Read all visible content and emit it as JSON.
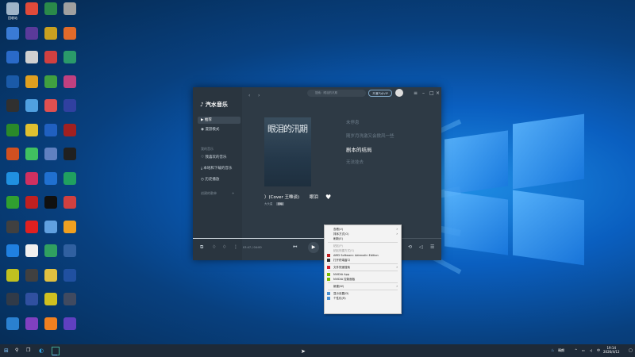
{
  "desktop": {
    "icons": [
      {
        "label": "回收站",
        "color": "#9fb4c8"
      },
      {
        "label": "",
        "color": "#e04a3a"
      },
      {
        "label": "",
        "color": "#2a8a4a"
      },
      {
        "label": "",
        "color": "#a0a0a0"
      },
      {
        "label": "",
        "color": "#3a7bd5"
      },
      {
        "label": "",
        "color": "#5a3a9a"
      },
      {
        "label": "",
        "color": "#c8a020"
      },
      {
        "label": "",
        "color": "#e06a2a"
      },
      {
        "label": "",
        "color": "#2a6ac8"
      },
      {
        "label": "",
        "color": "#d0d0d0"
      },
      {
        "label": "",
        "color": "#d04040"
      },
      {
        "label": "",
        "color": "#2a9a6a"
      },
      {
        "label": "",
        "color": "#1a5aa8"
      },
      {
        "label": "",
        "color": "#e0a020"
      },
      {
        "label": "",
        "color": "#40a040"
      },
      {
        "label": "",
        "color": "#c04080"
      },
      {
        "label": "",
        "color": "#303030"
      },
      {
        "label": "",
        "color": "#50a0e0"
      },
      {
        "label": "",
        "color": "#e05050"
      },
      {
        "label": "",
        "color": "#3040a0"
      },
      {
        "label": "",
        "color": "#2a8a2a"
      },
      {
        "label": "",
        "color": "#e0c030"
      },
      {
        "label": "",
        "color": "#2060c0"
      },
      {
        "label": "",
        "color": "#a02020"
      },
      {
        "label": "",
        "color": "#d05020"
      },
      {
        "label": "",
        "color": "#40c060"
      },
      {
        "label": "",
        "color": "#6080c0"
      },
      {
        "label": "",
        "color": "#202020"
      },
      {
        "label": "",
        "color": "#2090e0"
      },
      {
        "label": "",
        "color": "#d03060"
      },
      {
        "label": "",
        "color": "#2070d0"
      },
      {
        "label": "",
        "color": "#20a060"
      },
      {
        "label": "",
        "color": "#30a030"
      },
      {
        "label": "",
        "color": "#c02020"
      },
      {
        "label": "",
        "color": "#101010"
      },
      {
        "label": "",
        "color": "#d04040"
      },
      {
        "label": "",
        "color": "#404040"
      },
      {
        "label": "",
        "color": "#e02020"
      },
      {
        "label": "",
        "color": "#60a0e0"
      },
      {
        "label": "",
        "color": "#f0a020"
      },
      {
        "label": "",
        "color": "#2080e0"
      },
      {
        "label": "",
        "color": "#f0f0f0"
      },
      {
        "label": "",
        "color": "#30a060"
      },
      {
        "label": "",
        "color": "#3060a0"
      },
      {
        "label": "",
        "color": "#c0c020"
      },
      {
        "label": "",
        "color": "#404040"
      },
      {
        "label": "",
        "color": "#e0c040"
      },
      {
        "label": "",
        "color": "#2050a0"
      },
      {
        "label": "",
        "color": "#303a48"
      },
      {
        "label": "",
        "color": "#3050a0"
      },
      {
        "label": "",
        "color": "#d0c020"
      },
      {
        "label": "",
        "color": "#404a60"
      },
      {
        "label": "",
        "color": "#2a80d0"
      },
      {
        "label": "",
        "color": "#8040c0"
      },
      {
        "label": "",
        "color": "#f08020"
      },
      {
        "label": "",
        "color": "#6040c0"
      }
    ]
  },
  "app": {
    "name": "汽水音乐",
    "search_placeholder": "搜索：眼泪的汛期",
    "vip_label": "开通汽水VIP",
    "nav": {
      "recommend": "推荐",
      "roam": "漫游模式",
      "my_music_header": "我的音乐",
      "liked": "我喜欢的音乐",
      "downloads": "本地和下载的音乐",
      "history": "历史播放",
      "playlists_header": "创建的歌单"
    },
    "cover_title": "眼泪的汛期",
    "lyrics": [
      {
        "text": "未停息",
        "current": false
      },
      {
        "text": "随岁月洗激又会掀风一些",
        "current": false
      },
      {
        "text": "剧本的结局",
        "current": true
      },
      {
        "text": "无法挂去",
        "current": false
      }
    ],
    "song_title": "）(Cover 王唯谈)　　 眼泪",
    "artist": "大头星",
    "tag": "原唱",
    "time": "03:47 / 04:00",
    "progress": 0.77
  },
  "context_menu": {
    "items": [
      {
        "label": "查看(V)",
        "arrow": true,
        "disabled": false
      },
      {
        "label": "排序方式(O)",
        "arrow": true,
        "disabled": false
      },
      {
        "label": "刷新(E)",
        "arrow": false,
        "disabled": false
      },
      {
        "sep": true
      },
      {
        "label": "粘贴(P)",
        "arrow": false,
        "disabled": true
      },
      {
        "label": "粘贴快捷方式(S)",
        "arrow": false,
        "disabled": true
      },
      {
        "label": "AMD Software: Adrenalin Edition",
        "arrow": false,
        "disabled": false,
        "icon": "#c02020"
      },
      {
        "label": "打开终端窗口",
        "arrow": false,
        "disabled": false,
        "icon": "#303030"
      },
      {
        "sep": true
      },
      {
        "label": "文件快速搜索",
        "arrow": true,
        "disabled": false,
        "icon": "#d02030"
      },
      {
        "sep": true
      },
      {
        "label": "NVIDIA App",
        "arrow": false,
        "disabled": false,
        "icon": "#76b900"
      },
      {
        "label": "NVIDIA 控制面板",
        "arrow": false,
        "disabled": false,
        "icon": "#76b900"
      },
      {
        "sep": true
      },
      {
        "label": "新建(W)",
        "arrow": true,
        "disabled": false
      },
      {
        "sep": true
      },
      {
        "label": "显示设置(D)",
        "arrow": false,
        "disabled": false,
        "icon": "#4a90d0"
      },
      {
        "label": "个性化(R)",
        "arrow": false,
        "disabled": false,
        "icon": "#4a90d0"
      }
    ]
  },
  "taskbar": {
    "search_icon": "search-icon",
    "weather": "晴朗",
    "time": "19:14",
    "date": "2026/4/12"
  }
}
